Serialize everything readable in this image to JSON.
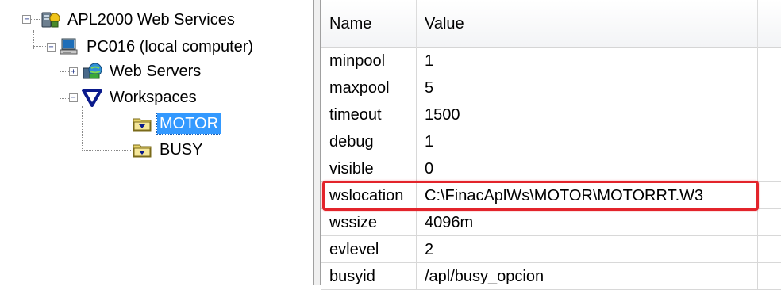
{
  "tree": {
    "root": {
      "label": "APL2000 Web Services",
      "expander": "−",
      "icon": "server-icon"
    },
    "computer": {
      "label": "PC016 (local computer)",
      "expander": "−",
      "icon": "computer-icon"
    },
    "web_servers": {
      "label": "Web Servers",
      "expander": "+",
      "icon": "globe-network-icon"
    },
    "workspaces": {
      "label": "Workspaces",
      "expander": "−",
      "icon": "triangle-down-icon"
    },
    "motor": {
      "label": "MOTOR",
      "selected": true,
      "icon": "folder-icon"
    },
    "busy": {
      "label": "BUSY",
      "icon": "folder-icon"
    }
  },
  "list": {
    "columns": [
      "Name",
      "Value"
    ],
    "rows": [
      {
        "name": "minpool",
        "value": "1"
      },
      {
        "name": "maxpool",
        "value": "5"
      },
      {
        "name": "timeout",
        "value": "1500"
      },
      {
        "name": "debug",
        "value": "1"
      },
      {
        "name": "visible",
        "value": "0"
      },
      {
        "name": "wslocation",
        "value": "C:\\FinacAplWs\\MOTOR\\MOTORRT.W3"
      },
      {
        "name": "wssize",
        "value": "4096m"
      },
      {
        "name": "evlevel",
        "value": "2"
      },
      {
        "name": "busyid",
        "value": "/apl/busy_opcion"
      }
    ],
    "highlighted_row": "wslocation",
    "highlight_color": "#e3242b"
  },
  "colors": {
    "selection": "#3399ff",
    "highlight": "#e3242b"
  }
}
